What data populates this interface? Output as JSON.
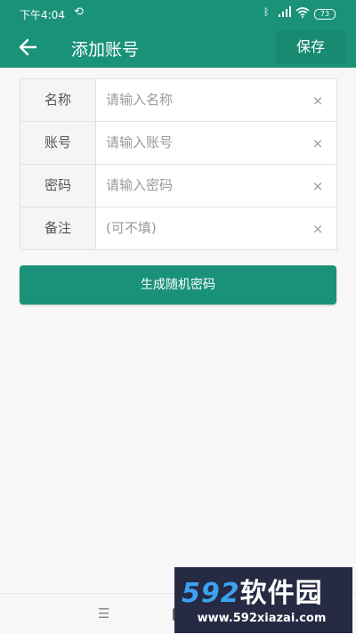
{
  "status_bar": {
    "time": "下午4:04",
    "sync_icon": "sync-off-icon",
    "bluetooth_icon": "bluetooth-icon",
    "signal_icon": "signal-icon",
    "wifi_icon": "wifi-icon",
    "battery": "73"
  },
  "toolbar": {
    "back_icon": "arrow-left-icon",
    "title": "添加账号",
    "save_label": "保存"
  },
  "form": {
    "rows": [
      {
        "label": "名称",
        "placeholder": "请输入名称",
        "value": ""
      },
      {
        "label": "账号",
        "placeholder": "请输入账号",
        "value": ""
      },
      {
        "label": "密码",
        "placeholder": "请输入密码",
        "value": ""
      },
      {
        "label": "备注",
        "placeholder": "(可不填)",
        "value": ""
      }
    ],
    "clear_glyph": "×"
  },
  "generate_button": "生成随机密码",
  "nav_bar": {
    "menu_glyph": "☰"
  },
  "watermark": {
    "brand_num": "592",
    "brand_cn": "软件园",
    "url": "www.592xiazai.com"
  },
  "colors": {
    "primary": "#1a9279",
    "background": "#f7f7f7"
  }
}
